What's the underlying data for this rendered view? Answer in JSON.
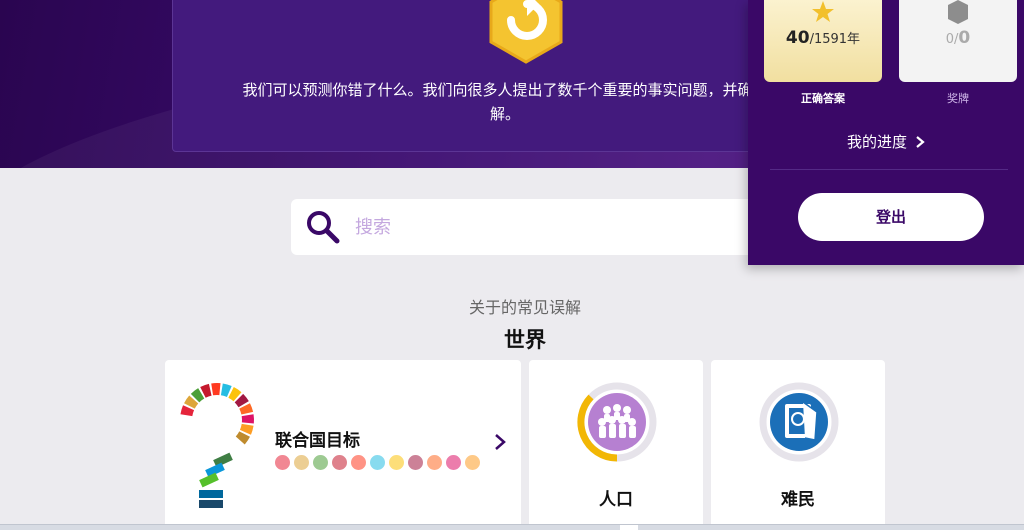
{
  "hero": {
    "text_line1": "我们可以预测你错了什么。我们向很多人提出了数千个重要的事实问题，并确定",
    "text_line2": "解。"
  },
  "search": {
    "placeholder": "搜索",
    "icon": "search-icon"
  },
  "section": {
    "subtitle": "关于的常见误解",
    "title": "世界"
  },
  "topics": [
    {
      "label": "联合国目标",
      "icon": "sdg-question-icon"
    },
    {
      "label": "人口",
      "icon": "population-icon"
    },
    {
      "label": "难民",
      "icon": "refugee-icon"
    }
  ],
  "sdg_colors": [
    "#e5243b",
    "#dda63a",
    "#4c9f38",
    "#c5192d",
    "#ff3a21",
    "#26bde2",
    "#fcc30b",
    "#a21942",
    "#fd6925",
    "#dd1367",
    "#fd9d24",
    "#bf8b2e",
    "#3f7e44",
    "#0a97d9",
    "#56c02b",
    "#00689d",
    "#19486a"
  ],
  "sdg_dot_colors": [
    "#e5243b",
    "#dda63a",
    "#4c9f38",
    "#c5192d",
    "#ff3a21",
    "#26bde2",
    "#fcc30b",
    "#a21942",
    "#fd6925",
    "#dd1367",
    "#fd9d24"
  ],
  "account_panel": {
    "correct_answers": {
      "value": "40",
      "total": "/1591年",
      "label": "正确答案",
      "icon": "star-icon"
    },
    "badges": {
      "value_small": "0/",
      "value": "0",
      "label": "奖牌",
      "icon": "badge-icon"
    },
    "progress_link": "我的进度",
    "logout_label": "登出"
  },
  "colors": {
    "brand_purple": "#3a0867",
    "accent_gold": "#f2c94c"
  }
}
